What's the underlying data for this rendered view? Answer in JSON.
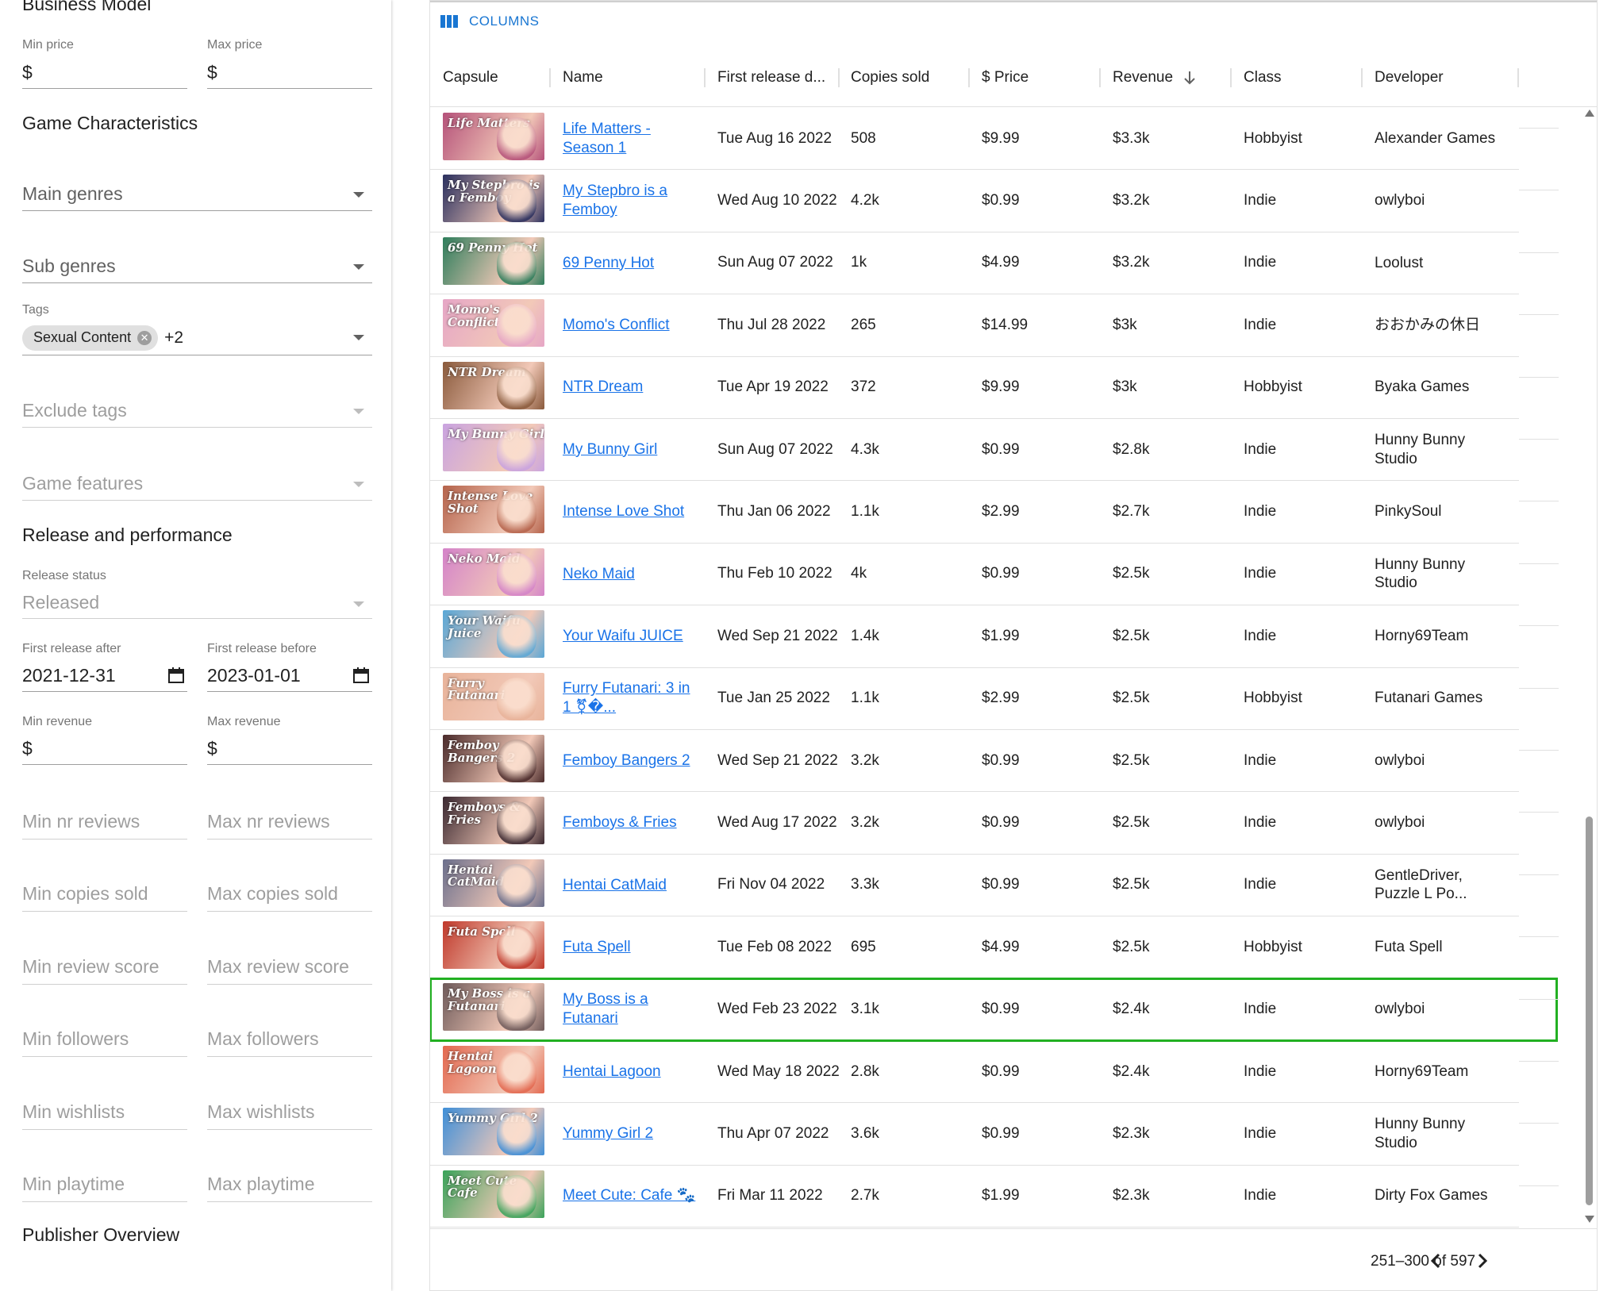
{
  "sidebar": {
    "business_model_title": "Business Model",
    "min_price_label": "Min price",
    "max_price_label": "Max price",
    "currency": "$",
    "game_characteristics_title": "Game Characteristics",
    "main_genres_placeholder": "Main genres",
    "sub_genres_placeholder": "Sub genres",
    "tags_label": "Tags",
    "tag_chip": "Sexual Content",
    "tag_more": "+2",
    "exclude_tags_placeholder": "Exclude tags",
    "game_features_placeholder": "Game features",
    "release_title": "Release and performance",
    "release_status_label": "Release status",
    "release_status_value": "Released",
    "first_release_after_label": "First release after",
    "first_release_after_value": "2021-12-31",
    "first_release_before_label": "First release before",
    "first_release_before_value": "2023-01-01",
    "min_revenue_label": "Min revenue",
    "max_revenue_label": "Max revenue",
    "min_reviews": "Min nr reviews",
    "max_reviews": "Max nr reviews",
    "min_copies": "Min copies sold",
    "max_copies": "Max copies sold",
    "min_review_score": "Min review score",
    "max_review_score": "Max review score",
    "min_followers": "Min followers",
    "max_followers": "Max followers",
    "min_wishlists": "Min wishlists",
    "max_wishlists": "Max wishlists",
    "min_playtime": "Min playtime",
    "max_playtime": "Max playtime",
    "publisher_overview_title": "Publisher Overview"
  },
  "grid": {
    "columns_button": "COLUMNS",
    "headers": {
      "capsule": "Capsule",
      "name": "Name",
      "first_release": "First release d...",
      "copies": "Copies sold",
      "price": "$ Price",
      "revenue": "Revenue",
      "class": "Class",
      "developer": "Developer"
    },
    "rows": [
      {
        "capsule_text": "Life Matters",
        "capsule_color": "#b5527a",
        "name": "Life Matters - Season 1",
        "date": "Tue Aug 16 2022",
        "copies": "508",
        "price": "$9.99",
        "revenue": "$3.3k",
        "class": "Hobbyist",
        "developer": "Alexander Games"
      },
      {
        "capsule_text": "My Stepbro is a Femboy",
        "capsule_color": "#2a2f5e",
        "name": "My Stepbro is a Femboy",
        "date": "Wed Aug 10 2022",
        "copies": "4.2k",
        "price": "$0.99",
        "revenue": "$3.2k",
        "class": "Indie",
        "developer": "owlyboi"
      },
      {
        "capsule_text": "69 Penny Hot",
        "capsule_color": "#2e7d5b",
        "name": "69 Penny Hot",
        "date": "Sun Aug 07 2022",
        "copies": "1k",
        "price": "$4.99",
        "revenue": "$3.2k",
        "class": "Indie",
        "developer": "Loolust"
      },
      {
        "capsule_text": "Momo's Conflict",
        "capsule_color": "#e6a6c6",
        "name": "Momo's Conflict",
        "date": "Thu Jul 28 2022",
        "copies": "265",
        "price": "$14.99",
        "revenue": "$3k",
        "class": "Indie",
        "developer": "おおかみの休日"
      },
      {
        "capsule_text": "NTR Dream",
        "capsule_color": "#8a5a3c",
        "name": "NTR Dream",
        "date": "Tue Apr 19 2022",
        "copies": "372",
        "price": "$9.99",
        "revenue": "$3k",
        "class": "Hobbyist",
        "developer": "Byaka Games"
      },
      {
        "capsule_text": "My Bunny Girl",
        "capsule_color": "#c9a3e0",
        "name": "My Bunny Girl",
        "date": "Sun Aug 07 2022",
        "copies": "4.3k",
        "price": "$0.99",
        "revenue": "$2.8k",
        "class": "Indie",
        "developer": "Hunny Bunny Studio"
      },
      {
        "capsule_text": "Intense Love Shot",
        "capsule_color": "#b5634b",
        "name": "Intense Love Shot",
        "date": "Thu Jan 06 2022",
        "copies": "1.1k",
        "price": "$2.99",
        "revenue": "$2.7k",
        "class": "Indie",
        "developer": "PinkySoul"
      },
      {
        "capsule_text": "Neko Maid",
        "capsule_color": "#d483c9",
        "name": "Neko Maid",
        "date": "Thu Feb 10 2022",
        "copies": "4k",
        "price": "$0.99",
        "revenue": "$2.5k",
        "class": "Indie",
        "developer": "Hunny Bunny Studio"
      },
      {
        "capsule_text": "Your Waifu Juice",
        "capsule_color": "#5aa7d6",
        "name": "Your Waifu JUICE",
        "date": "Wed Sep 21 2022",
        "copies": "1.4k",
        "price": "$1.99",
        "revenue": "$2.5k",
        "class": "Indie",
        "developer": "Horny69Team"
      },
      {
        "capsule_text": "Furry Futanari",
        "capsule_color": "#e8b39a",
        "name": "Furry Futanari: 3 in 1 ⚧�...",
        "date": "Tue Jan 25 2022",
        "copies": "1.1k",
        "price": "$2.99",
        "revenue": "$2.5k",
        "class": "Hobbyist",
        "developer": "Futanari Games"
      },
      {
        "capsule_text": "Femboy Bangers 2",
        "capsule_color": "#4a2a2a",
        "name": "Femboy Bangers 2",
        "date": "Wed Sep 21 2022",
        "copies": "3.2k",
        "price": "$0.99",
        "revenue": "$2.5k",
        "class": "Indie",
        "developer": "owlyboi"
      },
      {
        "capsule_text": "Femboys & Fries",
        "capsule_color": "#3a2830",
        "name": "Femboys & Fries",
        "date": "Wed Aug 17 2022",
        "copies": "3.2k",
        "price": "$0.99",
        "revenue": "$2.5k",
        "class": "Indie",
        "developer": "owlyboi"
      },
      {
        "capsule_text": "Hentai CatMaid",
        "capsule_color": "#6b6f8c",
        "name": "Hentai CatMaid",
        "date": "Fri Nov 04 2022",
        "copies": "3.3k",
        "price": "$0.99",
        "revenue": "$2.5k",
        "class": "Indie",
        "developer": "GentleDriver, Puzzle L Po..."
      },
      {
        "capsule_text": "Futa Spell",
        "capsule_color": "#c0392b",
        "name": "Futa Spell",
        "date": "Tue Feb 08 2022",
        "copies": "695",
        "price": "$4.99",
        "revenue": "$2.5k",
        "class": "Hobbyist",
        "developer": "Futa Spell"
      },
      {
        "capsule_text": "My Boss is a Futanari",
        "capsule_color": "#6e5a5a",
        "name": "My Boss is a Futanari",
        "date": "Wed Feb 23 2022",
        "copies": "3.1k",
        "price": "$0.99",
        "revenue": "$2.4k",
        "class": "Indie",
        "developer": "owlyboi"
      },
      {
        "capsule_text": "Hentai Lagoon",
        "capsule_color": "#e3684f",
        "name": "Hentai Lagoon",
        "date": "Wed May 18 2022",
        "copies": "2.8k",
        "price": "$0.99",
        "revenue": "$2.4k",
        "class": "Indie",
        "developer": "Horny69Team"
      },
      {
        "capsule_text": "Yummy Girl 2",
        "capsule_color": "#3f8fd8",
        "name": "Yummy Girl 2",
        "date": "Thu Apr 07 2022",
        "copies": "3.6k",
        "price": "$0.99",
        "revenue": "$2.3k",
        "class": "Indie",
        "developer": "Hunny Bunny Studio"
      },
      {
        "capsule_text": "Meet Cute Cafe",
        "capsule_color": "#3aa35a",
        "name": "Meet Cute: Cafe 🐾",
        "date": "Fri Mar 11 2022",
        "copies": "2.7k",
        "price": "$1.99",
        "revenue": "$2.3k",
        "class": "Indie",
        "developer": "Dirty Fox Games"
      }
    ],
    "pagination": "251–300 of 597"
  },
  "colors": {
    "accent": "#1976d2",
    "link": "#1a73e8",
    "highlight": "#22b022"
  }
}
